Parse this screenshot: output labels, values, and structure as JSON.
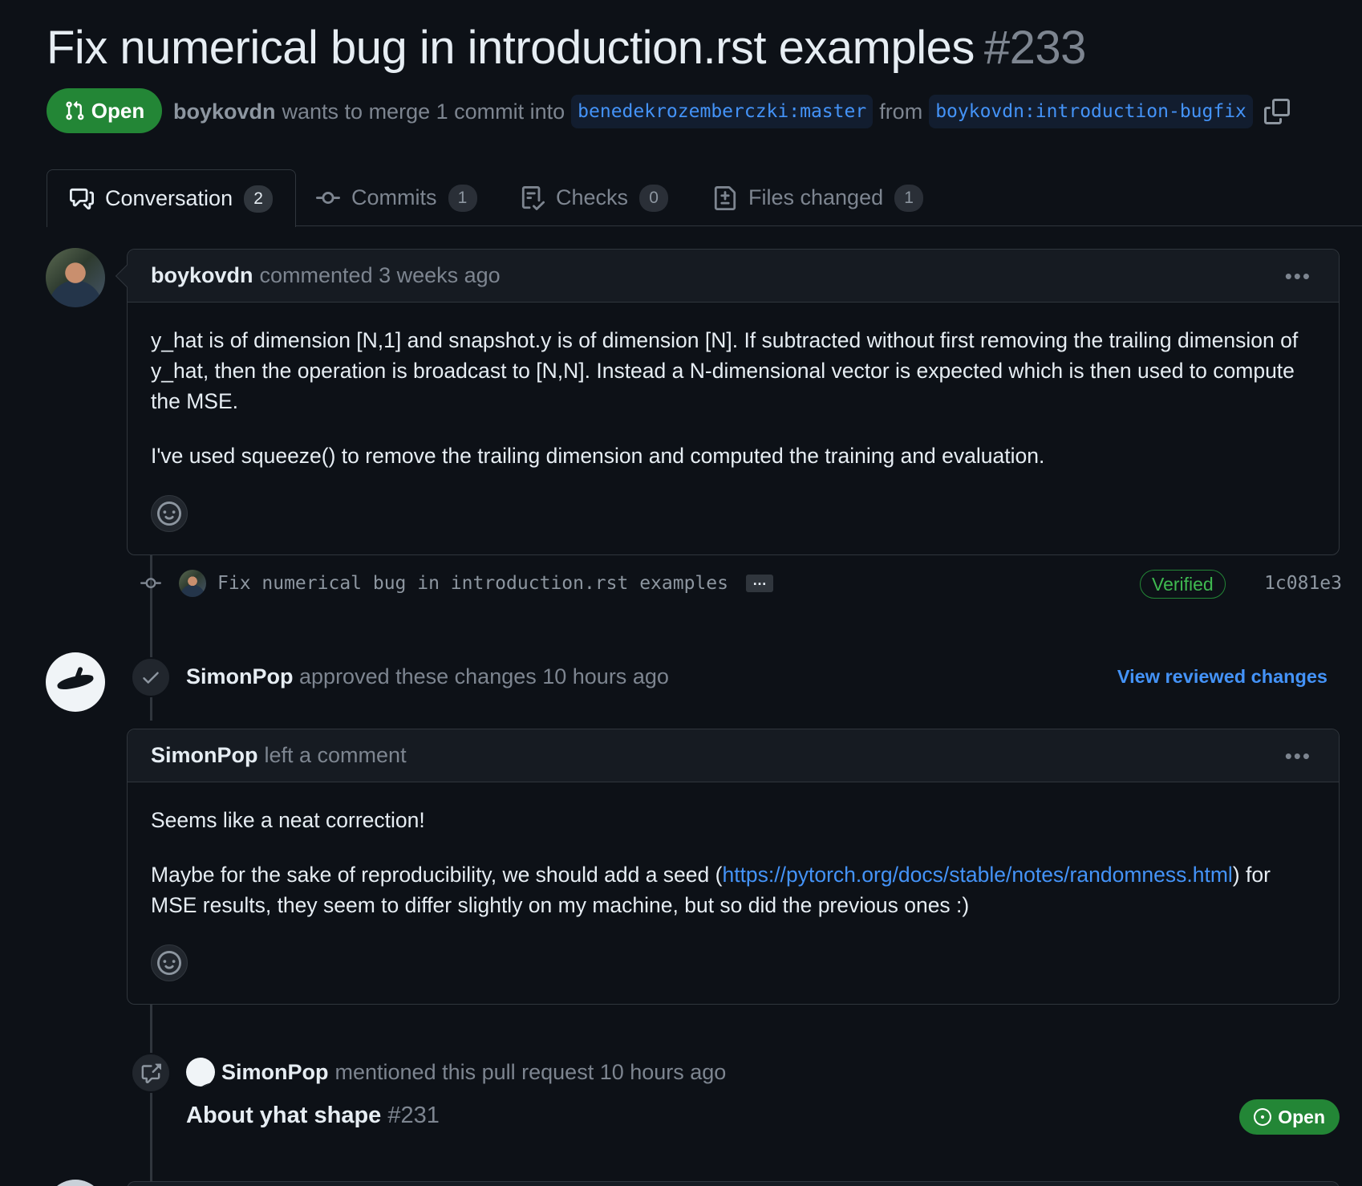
{
  "pr": {
    "title": "Fix numerical bug in introduction.rst examples",
    "number": "#233",
    "state": "Open",
    "author": "boykovdn",
    "merge_text": "wants to merge 1 commit into",
    "base_branch": "benedekrozemberczki:master",
    "from_text": "from",
    "head_branch": "boykovdn:introduction-bugfix"
  },
  "tabs": [
    {
      "label": "Conversation",
      "count": "2"
    },
    {
      "label": "Commits",
      "count": "1"
    },
    {
      "label": "Checks",
      "count": "0"
    },
    {
      "label": "Files changed",
      "count": "1"
    }
  ],
  "comment1": {
    "author": "boykovdn",
    "action": "commented 3 weeks ago",
    "para1": "y_hat is of dimension [N,1] and snapshot.y is of dimension [N]. If subtracted without first removing the trailing dimension of y_hat, then the operation is broadcast to [N,N]. Instead a N-dimensional vector is expected which is then used to compute the MSE.",
    "para2": "I've used squeeze() to remove the trailing dimension and computed the training and evaluation."
  },
  "commit": {
    "message": "Fix numerical bug in introduction.rst examples",
    "ellipsis": "…",
    "verified": "Verified",
    "sha": "1c081e3"
  },
  "review": {
    "author": "SimonPop",
    "action": "approved these changes 10 hours ago",
    "link": "View reviewed changes"
  },
  "comment2": {
    "author": "SimonPop",
    "action": "left a comment",
    "para1": "Seems like a neat correction!",
    "para2_before": "Maybe for the sake of reproducibility, we should add a seed (",
    "link": "https://pytorch.org/docs/stable/notes/randomness.html",
    "para2_after": ") for MSE results, they seem to differ slightly on my machine, but so did the previous ones :)"
  },
  "mention": {
    "author": "SimonPop",
    "action": "mentioned this pull request 10 hours ago",
    "title": "About yhat shape",
    "number": "#231",
    "state": "Open"
  },
  "colors": {
    "background": "#0d1117",
    "open_green": "#238636",
    "link_blue": "#4493f8",
    "muted": "#7d8590"
  }
}
